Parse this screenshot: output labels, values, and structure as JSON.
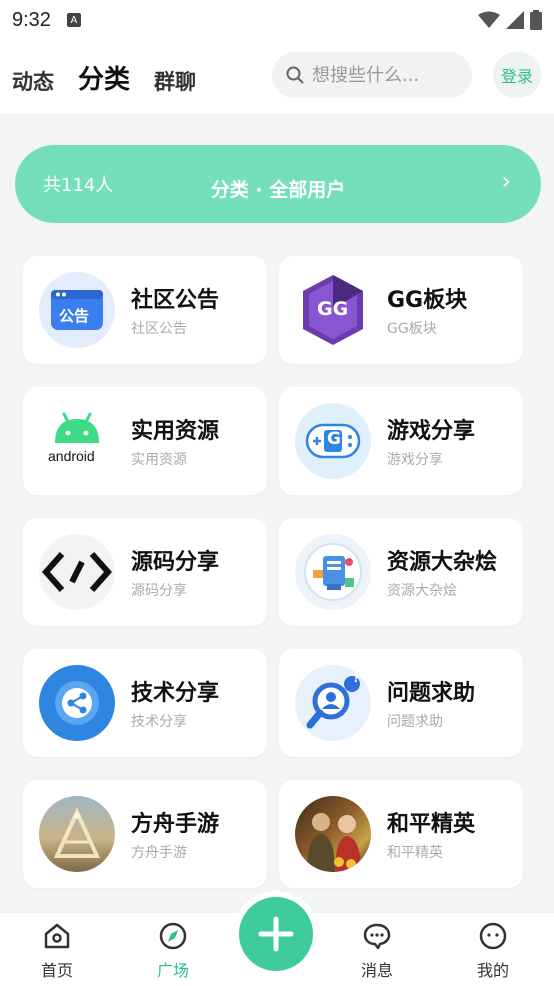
{
  "status_bar": {
    "time": "9:32",
    "notif_glyph": "A"
  },
  "header": {
    "tabs": [
      {
        "label": "动态"
      },
      {
        "label": "分类"
      },
      {
        "label": "群聊"
      }
    ],
    "search": {
      "placeholder": "想搜些什么..."
    },
    "login_label": "登录"
  },
  "banner": {
    "count": "共114人",
    "title": "分类 · 全部用户",
    "chevron": "›"
  },
  "categories": [
    {
      "title": "社区公告",
      "subtitle": "社区公告",
      "icon": "announcement-icon",
      "badge": "公告"
    },
    {
      "title": "GG板块",
      "subtitle": "GG板块",
      "icon": "gg-logo-icon",
      "badge": "GG"
    },
    {
      "title": "实用资源",
      "subtitle": "实用资源",
      "icon": "android-icon",
      "badge": "android"
    },
    {
      "title": "游戏分享",
      "subtitle": "游戏分享",
      "icon": "gamepad-icon",
      "badge": "G"
    },
    {
      "title": "源码分享",
      "subtitle": "源码分享",
      "icon": "code-icon",
      "badge": ""
    },
    {
      "title": "资源大杂烩",
      "subtitle": "资源大杂烩",
      "icon": "resources-icon",
      "badge": ""
    },
    {
      "title": "技术分享",
      "subtitle": "技术分享",
      "icon": "share-icon",
      "badge": ""
    },
    {
      "title": "问题求助",
      "subtitle": "问题求助",
      "icon": "help-search-icon",
      "badge": "?"
    },
    {
      "title": "方舟手游",
      "subtitle": "方舟手游",
      "icon": "ark-game-icon",
      "badge": ""
    },
    {
      "title": "和平精英",
      "subtitle": "和平精英",
      "icon": "pubg-game-icon",
      "badge": ""
    }
  ],
  "bottom_nav": {
    "items": [
      {
        "label": "首页",
        "icon": "home-icon"
      },
      {
        "label": "广场",
        "icon": "compass-icon"
      },
      {
        "label": "消息",
        "icon": "chat-icon"
      },
      {
        "label": "我的",
        "icon": "profile-icon"
      }
    ],
    "fab_icon": "plus-icon"
  },
  "colors": {
    "accent": "#3fcc9c",
    "banner": "#74dfb8",
    "active_text": "#2fbf8a"
  }
}
